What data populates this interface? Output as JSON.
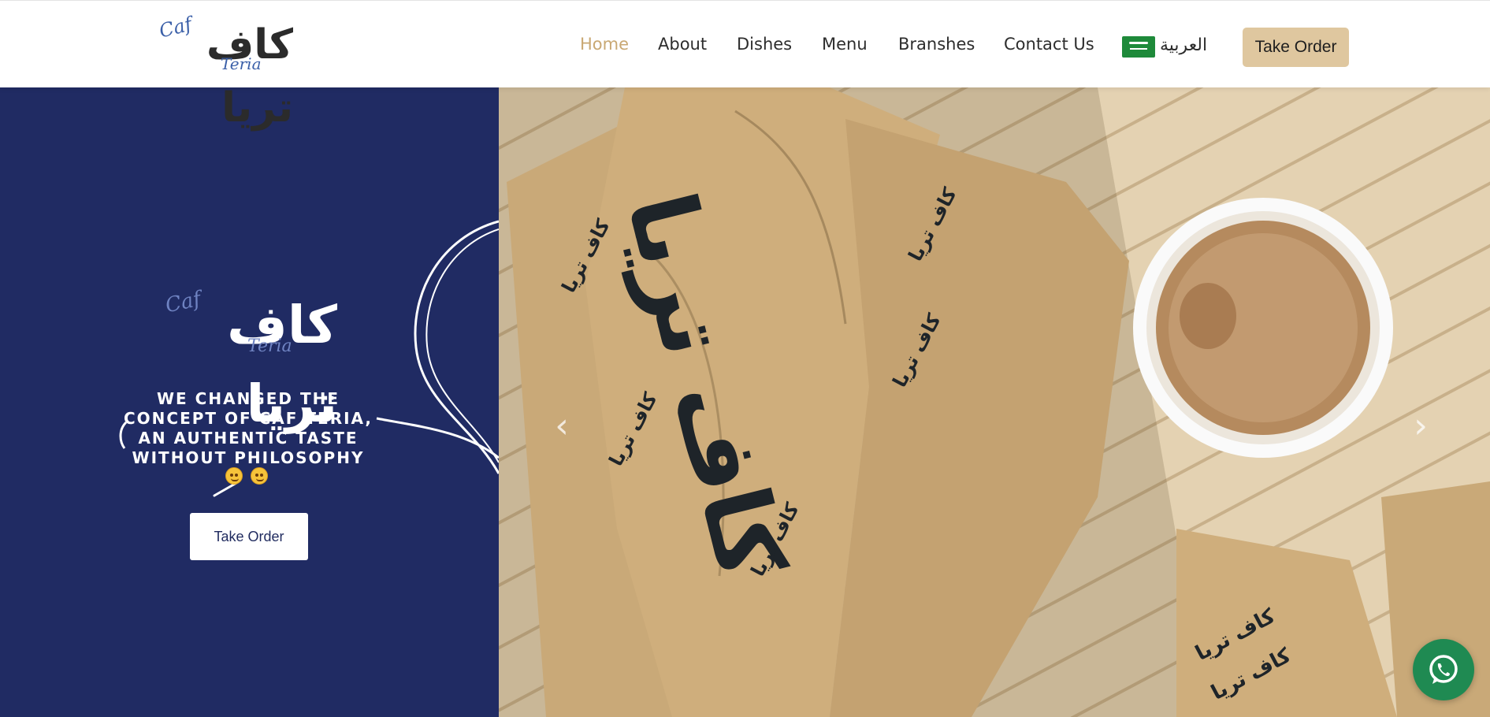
{
  "brand": {
    "logo_text_ar": "كاف تريا",
    "logo_script_top": "Caf",
    "logo_script_bottom": "Teria",
    "colors": {
      "navy": "#202b63",
      "gold": "#c9a873",
      "button_gold": "#dfc79f",
      "whatsapp": "#1f8a52"
    }
  },
  "nav": {
    "items": [
      {
        "label": "Home",
        "active": true
      },
      {
        "label": "About",
        "active": false
      },
      {
        "label": "Dishes",
        "active": false
      },
      {
        "label": "Menu",
        "active": false
      },
      {
        "label": "Branshes",
        "active": false
      },
      {
        "label": "Contact Us",
        "active": false
      }
    ],
    "language_label": "العربية",
    "language_icon": "saudi-flag-icon",
    "cta_label": "Take Order"
  },
  "hero": {
    "logo_text_ar": "كاف تريا",
    "logo_script_top": "Caf",
    "logo_script_bottom": "Teria",
    "tagline": "WE CHANGED THE CONCEPT OF CAF TERIA, AN AUTHENTIC TASTE WITHOUT PHILOSOPHY",
    "emojis": [
      "wink-face-icon",
      "yum-face-icon"
    ],
    "cta_label": "Take Order",
    "photo_wrap_text": "كاف تريا",
    "prev_icon": "chevron-left-icon",
    "next_icon": "chevron-right-icon",
    "prev_glyph": "‹",
    "next_glyph": "›"
  },
  "whatsapp": {
    "icon": "whatsapp-icon"
  }
}
